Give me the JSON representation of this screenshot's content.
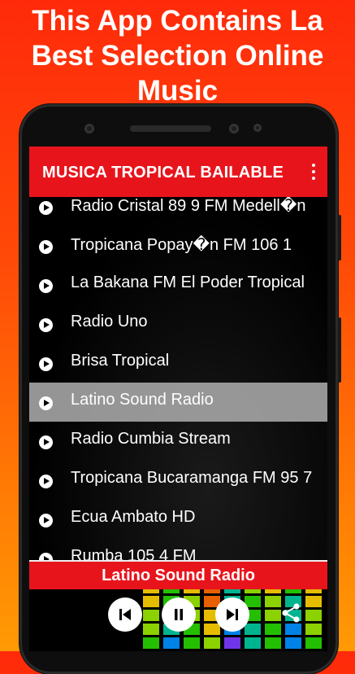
{
  "promo": {
    "line1_bold": "This",
    "line1_rest": " App Contains La",
    "line2": "Best Selection Online",
    "line3": "Music"
  },
  "appbar": {
    "title": "MUSICA TROPICAL BAILABLE",
    "menu_icon": "more-vert-icon"
  },
  "stations": [
    {
      "label": "Radio Cristal 89 9 FM Medell�n",
      "selected": false
    },
    {
      "label": "Tropicana Popay�n FM 106 1",
      "selected": false
    },
    {
      "label": "La Bakana FM El Poder Tropical",
      "selected": false
    },
    {
      "label": "Radio Uno",
      "selected": false
    },
    {
      "label": "Brisa Tropical",
      "selected": false
    },
    {
      "label": "Latino Sound Radio",
      "selected": true
    },
    {
      "label": "Radio Cumbia Stream",
      "selected": false
    },
    {
      "label": "Tropicana Bucaramanga FM 95 7",
      "selected": false
    },
    {
      "label": "Ecua Ambato HD",
      "selected": false
    },
    {
      "label": "Rumba 105 4 FM",
      "selected": false
    }
  ],
  "player": {
    "now_playing": "Latino Sound Radio",
    "controls": [
      "skip-previous-icon",
      "pause-icon",
      "skip-next-icon",
      "share-icon"
    ]
  },
  "colors": {
    "accent": "#e8141c",
    "background_top": "#ff2a0a",
    "background_bottom": "#ff9a04",
    "selected_row": "#aaaaaa"
  }
}
